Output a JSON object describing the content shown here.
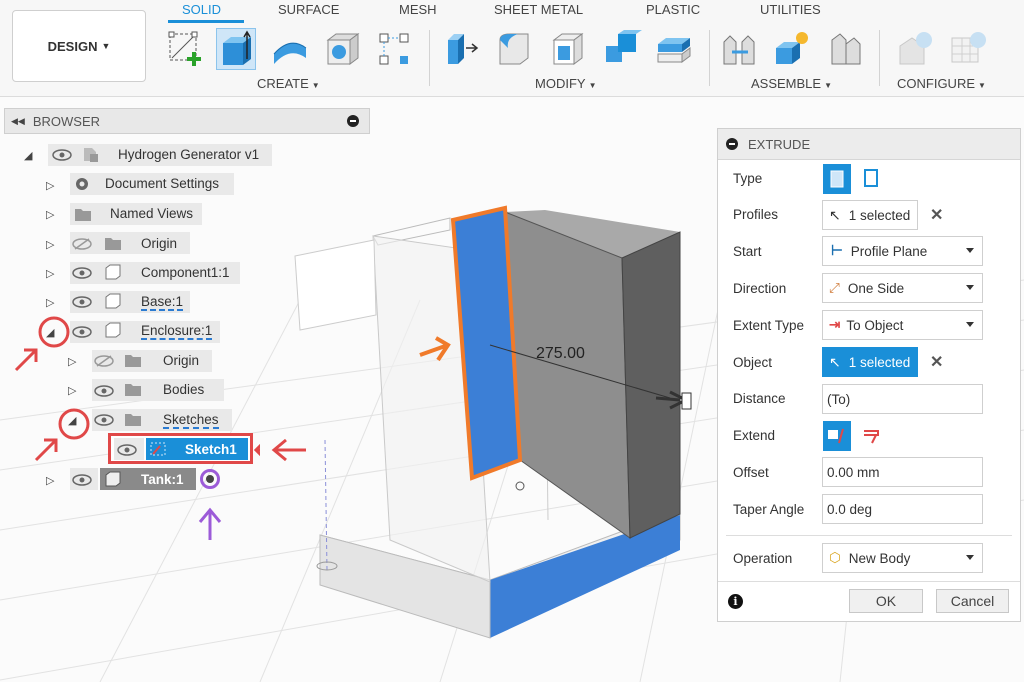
{
  "toolbar": {
    "workspace_label": "DESIGN",
    "tabs": [
      "SOLID",
      "SURFACE",
      "MESH",
      "SHEET METAL",
      "PLASTIC",
      "UTILITIES"
    ],
    "groups": {
      "create": "CREATE",
      "modify": "MODIFY",
      "assemble": "ASSEMBLE",
      "configure": "CONFIGURE"
    }
  },
  "browser": {
    "title": "BROWSER",
    "items": [
      {
        "label": "Hydrogen Generator v1"
      },
      {
        "label": "Document Settings"
      },
      {
        "label": "Named Views"
      },
      {
        "label": "Origin"
      },
      {
        "label": "Component1:1"
      },
      {
        "label": "Base:1"
      },
      {
        "label": "Enclosure:1"
      },
      {
        "label": "Origin"
      },
      {
        "label": "Bodies"
      },
      {
        "label": "Sketches"
      },
      {
        "label": "Sketch1"
      },
      {
        "label": "Tank:1"
      }
    ]
  },
  "viewport": {
    "dimension_label": "275.00"
  },
  "extrude": {
    "title": "EXTRUDE",
    "rows": {
      "type": "Type",
      "profiles": "Profiles",
      "start": "Start",
      "direction": "Direction",
      "extent_type": "Extent Type",
      "object": "Object",
      "distance": "Distance",
      "extend": "Extend",
      "offset": "Offset",
      "taper": "Taper Angle",
      "operation": "Operation"
    },
    "values": {
      "profiles": "1 selected",
      "start": "Profile Plane",
      "direction": "One Side",
      "extent_type": "To Object",
      "object": "1 selected",
      "distance": "(To)",
      "offset": "0.00 mm",
      "taper": "0.0 deg",
      "operation": "New Body"
    },
    "ok": "OK",
    "cancel": "Cancel"
  },
  "colors": {
    "accent": "#1a8fd8",
    "annotation_red": "#e04848",
    "annotation_orange": "#f07a2a",
    "annotation_purple": "#9c5bd8",
    "face_blue": "#3c7fd6"
  }
}
